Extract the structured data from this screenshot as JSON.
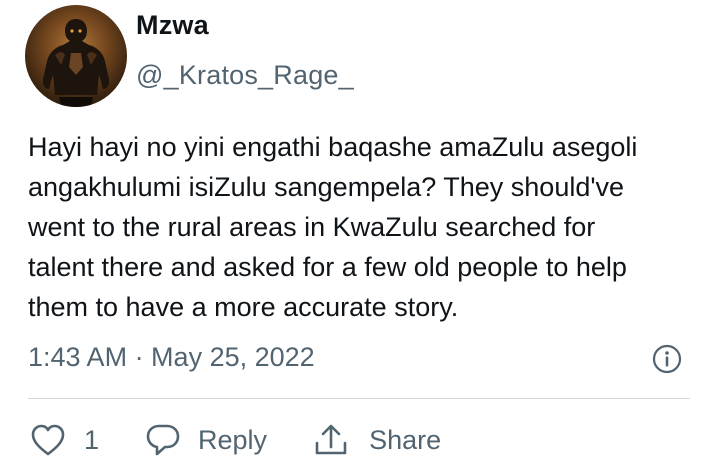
{
  "user": {
    "display_name": "Mzwa",
    "handle": "@_Kratos_Rage_",
    "avatar_icon": "warrior-avatar"
  },
  "tweet": {
    "text_lines": [
      "Hayi hayi no yini engathi baqashe amaZulu asegoli",
      "angakhulumi isiZulu sangempela? They should've",
      "went to the rural areas in KwaZulu searched for",
      "talent there and asked for a few old people to help",
      "them to have a more accurate story."
    ],
    "timestamp": "1:43 AM · May 25, 2022"
  },
  "actions": {
    "like_count": "1",
    "reply_label": "Reply",
    "share_label": "Share"
  },
  "colors": {
    "text_primary": "#0f1419",
    "text_secondary": "#536471",
    "divider": "#cfd9de",
    "background": "#ffffff"
  }
}
